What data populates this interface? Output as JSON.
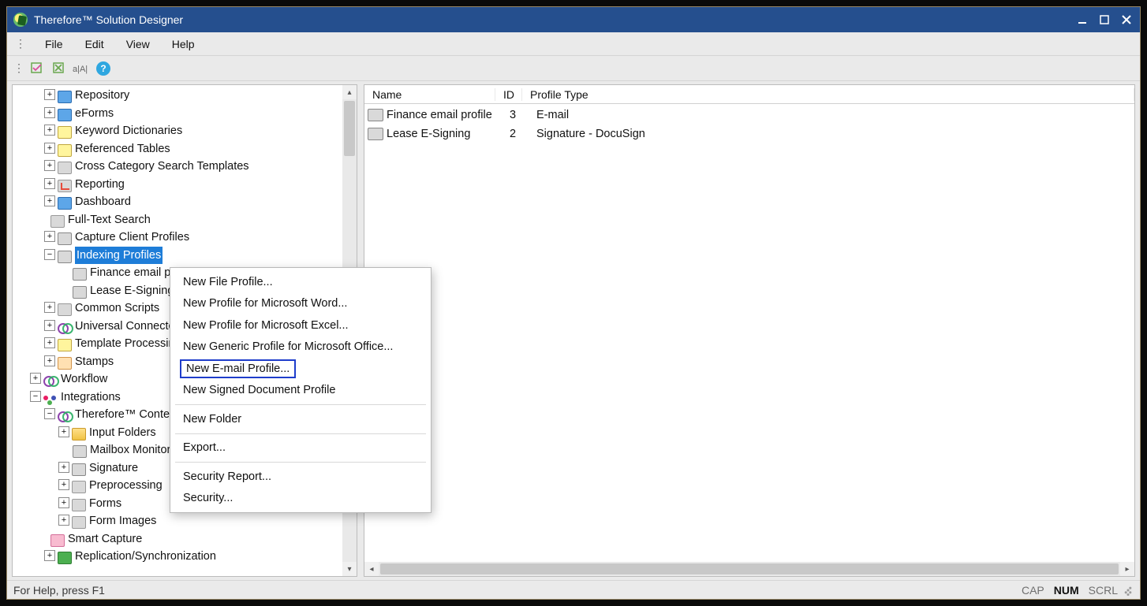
{
  "title": "Therefore™ Solution Designer",
  "menus": {
    "file": "File",
    "edit": "Edit",
    "view": "View",
    "help": "Help"
  },
  "tree": {
    "repository": "Repository",
    "eforms": "eForms",
    "keyword_dictionaries": "Keyword Dictionaries",
    "referenced_tables": "Referenced Tables",
    "cross_category_search_templates": "Cross Category Search Templates",
    "reporting": "Reporting",
    "dashboard": "Dashboard",
    "full_text_search": "Full-Text Search",
    "capture_client_profiles": "Capture Client Profiles",
    "indexing_profiles": "Indexing Profiles",
    "finance_email_profile": "Finance email profile",
    "lease_esigning": "Lease E-Signing",
    "common_scripts": "Common Scripts",
    "universal_connector": "Universal Connector",
    "template_processing": "Template Processing",
    "stamps": "Stamps",
    "workflow": "Workflow",
    "integrations": "Integrations",
    "therefore_content": "Therefore™ Content Connector",
    "input_folders": "Input Folders",
    "mailbox_monitoring": "Mailbox Monitoring",
    "signature": "Signature",
    "preprocessing": "Preprocessing",
    "forms": "Forms",
    "form_images": "Form Images",
    "smart_capture": "Smart Capture",
    "replication_sync": "Replication/Synchronization"
  },
  "context_menu": {
    "new_file_profile": "New File Profile...",
    "new_profile_word": "New Profile for Microsoft Word...",
    "new_profile_excel": "New Profile for Microsoft Excel...",
    "new_generic_office": "New Generic Profile for Microsoft Office...",
    "new_email_profile": "New E-mail Profile...",
    "new_signed_document": "New Signed Document Profile",
    "new_folder": "New Folder",
    "export": "Export...",
    "security_report": "Security Report...",
    "security": "Security..."
  },
  "columns": {
    "name": "Name",
    "id": "ID",
    "profile_type": "Profile Type"
  },
  "rows": [
    {
      "name": "Finance email profile",
      "id": "3",
      "type": "E-mail"
    },
    {
      "name": "Lease E-Signing",
      "id": "2",
      "type": "Signature - DocuSign"
    }
  ],
  "status": {
    "hint": "For Help, press F1",
    "cap": "CAP",
    "num": "NUM",
    "scrl": "SCRL"
  }
}
